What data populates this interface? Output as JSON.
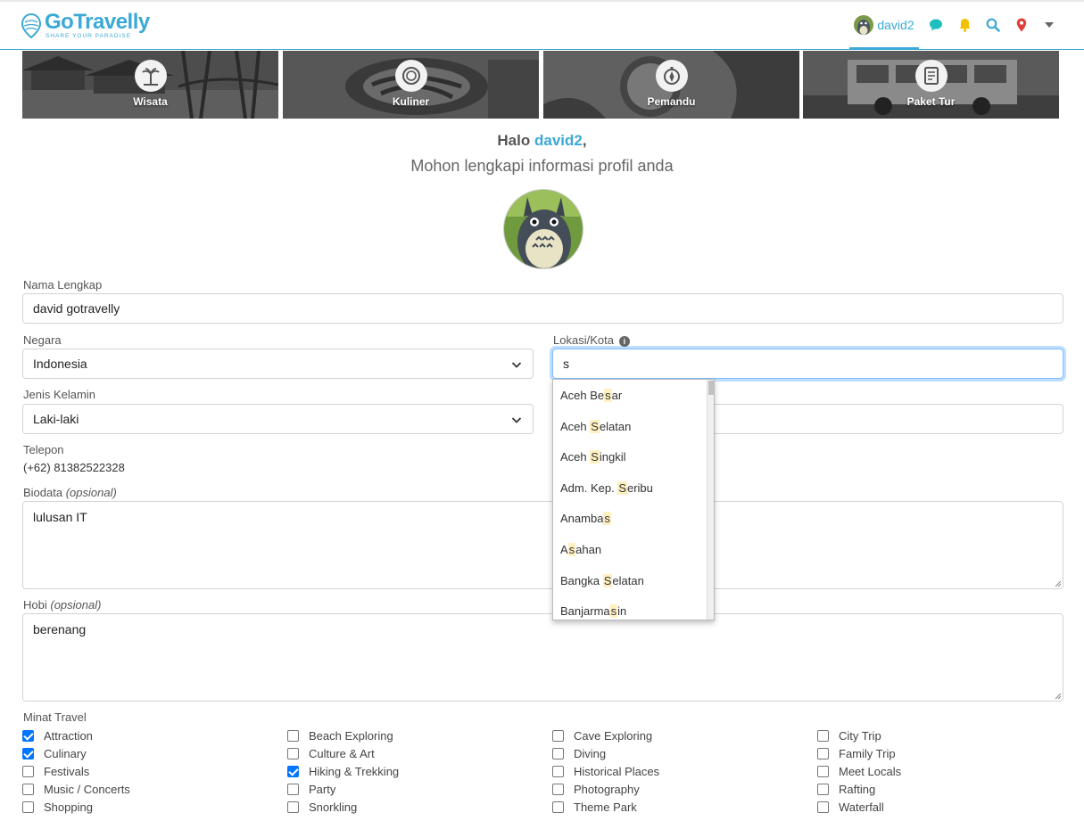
{
  "brand": {
    "name": "GoTravelly",
    "tagline": "SHARE YOUR PARADISE",
    "color": "#3aa9d6"
  },
  "nav": {
    "username": "david2",
    "icons": [
      "chat-icon",
      "bell-icon",
      "search-icon",
      "location-pin-icon",
      "caret-down-icon"
    ],
    "icon_colors": {
      "chat": "#1fbfbf",
      "bell": "#f5c000",
      "search": "#3aa9d6",
      "pin": "#e0403a",
      "caret": "#666666"
    }
  },
  "categories": [
    {
      "label": "Wisata",
      "icon": "palm-tree-icon"
    },
    {
      "label": "Kuliner",
      "icon": "food-bowl-icon"
    },
    {
      "label": "Pemandu",
      "icon": "compass-icon"
    },
    {
      "label": "Paket Tur",
      "icon": "checklist-icon"
    }
  ],
  "greeting": {
    "prefix": "Halo",
    "name": "david2",
    "suffix": ",",
    "subtitle": "Mohon lengkapi informasi profil anda"
  },
  "form": {
    "full_name": {
      "label": "Nama Lengkap",
      "value": "david gotravelly"
    },
    "country": {
      "label": "Negara",
      "value": "Indonesia"
    },
    "city": {
      "label": "Lokasi/Kota",
      "value": "s"
    },
    "gender": {
      "label": "Jenis Kelamin",
      "value": "Laki-laki"
    },
    "phone": {
      "label": "Telepon",
      "value": "(+62) 81382522328"
    },
    "bio": {
      "label": "Biodata",
      "optional": "(opsional)",
      "value": "lulusan IT"
    },
    "hobby": {
      "label": "Hobi",
      "optional": "(opsional)",
      "value": "berenang"
    },
    "interests_label": "Minat Travel"
  },
  "city_suggestions": [
    {
      "pre": "Aceh Be",
      "match": "s",
      "post": "ar"
    },
    {
      "pre": "Aceh ",
      "match": "S",
      "post": "elatan"
    },
    {
      "pre": "Aceh ",
      "match": "S",
      "post": "ingkil"
    },
    {
      "pre": "Adm. Kep. ",
      "match": "S",
      "post": "eribu"
    },
    {
      "pre": "Anamba",
      "match": "s",
      "post": ""
    },
    {
      "pre": "A",
      "match": "s",
      "post": "ahan"
    },
    {
      "pre": "Bangka ",
      "match": "S",
      "post": "elatan"
    },
    {
      "pre": "Banjarma",
      "match": "s",
      "post": "in"
    }
  ],
  "interests": [
    [
      {
        "label": "Attraction",
        "checked": true
      },
      {
        "label": "Culinary",
        "checked": true
      },
      {
        "label": "Festivals",
        "checked": false
      },
      {
        "label": "Music / Concerts",
        "checked": false
      },
      {
        "label": "Shopping",
        "checked": false
      }
    ],
    [
      {
        "label": "Beach Exploring",
        "checked": false
      },
      {
        "label": "Culture & Art",
        "checked": false
      },
      {
        "label": "Hiking & Trekking",
        "checked": true
      },
      {
        "label": "Party",
        "checked": false
      },
      {
        "label": "Snorkling",
        "checked": false
      }
    ],
    [
      {
        "label": "Cave Exploring",
        "checked": false
      },
      {
        "label": "Diving",
        "checked": false
      },
      {
        "label": "Historical Places",
        "checked": false
      },
      {
        "label": "Photography",
        "checked": false
      },
      {
        "label": "Theme Park",
        "checked": false
      }
    ],
    [
      {
        "label": "City Trip",
        "checked": false
      },
      {
        "label": "Family Trip",
        "checked": false
      },
      {
        "label": "Meet Locals",
        "checked": false
      },
      {
        "label": "Rafting",
        "checked": false
      },
      {
        "label": "Waterfall",
        "checked": false
      }
    ]
  ]
}
